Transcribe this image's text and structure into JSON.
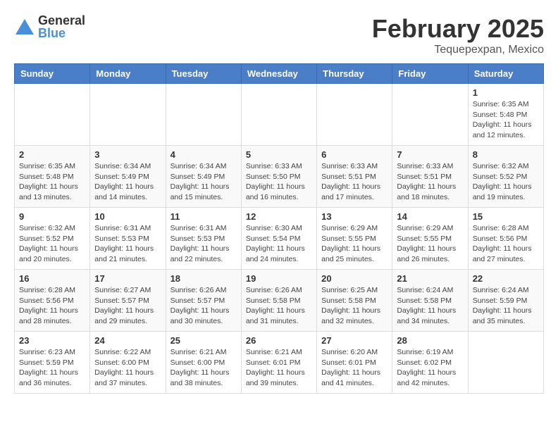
{
  "header": {
    "logo": {
      "general": "General",
      "blue": "Blue"
    },
    "title": "February 2025",
    "location": "Tequepexpan, Mexico"
  },
  "calendar": {
    "days_of_week": [
      "Sunday",
      "Monday",
      "Tuesday",
      "Wednesday",
      "Thursday",
      "Friday",
      "Saturday"
    ],
    "weeks": [
      [
        {
          "day": "",
          "info": ""
        },
        {
          "day": "",
          "info": ""
        },
        {
          "day": "",
          "info": ""
        },
        {
          "day": "",
          "info": ""
        },
        {
          "day": "",
          "info": ""
        },
        {
          "day": "",
          "info": ""
        },
        {
          "day": "1",
          "info": "Sunrise: 6:35 AM\nSunset: 5:48 PM\nDaylight: 11 hours\nand 12 minutes."
        }
      ],
      [
        {
          "day": "2",
          "info": "Sunrise: 6:35 AM\nSunset: 5:48 PM\nDaylight: 11 hours\nand 13 minutes."
        },
        {
          "day": "3",
          "info": "Sunrise: 6:34 AM\nSunset: 5:49 PM\nDaylight: 11 hours\nand 14 minutes."
        },
        {
          "day": "4",
          "info": "Sunrise: 6:34 AM\nSunset: 5:49 PM\nDaylight: 11 hours\nand 15 minutes."
        },
        {
          "day": "5",
          "info": "Sunrise: 6:33 AM\nSunset: 5:50 PM\nDaylight: 11 hours\nand 16 minutes."
        },
        {
          "day": "6",
          "info": "Sunrise: 6:33 AM\nSunset: 5:51 PM\nDaylight: 11 hours\nand 17 minutes."
        },
        {
          "day": "7",
          "info": "Sunrise: 6:33 AM\nSunset: 5:51 PM\nDaylight: 11 hours\nand 18 minutes."
        },
        {
          "day": "8",
          "info": "Sunrise: 6:32 AM\nSunset: 5:52 PM\nDaylight: 11 hours\nand 19 minutes."
        }
      ],
      [
        {
          "day": "9",
          "info": "Sunrise: 6:32 AM\nSunset: 5:52 PM\nDaylight: 11 hours\nand 20 minutes."
        },
        {
          "day": "10",
          "info": "Sunrise: 6:31 AM\nSunset: 5:53 PM\nDaylight: 11 hours\nand 21 minutes."
        },
        {
          "day": "11",
          "info": "Sunrise: 6:31 AM\nSunset: 5:53 PM\nDaylight: 11 hours\nand 22 minutes."
        },
        {
          "day": "12",
          "info": "Sunrise: 6:30 AM\nSunset: 5:54 PM\nDaylight: 11 hours\nand 24 minutes."
        },
        {
          "day": "13",
          "info": "Sunrise: 6:29 AM\nSunset: 5:55 PM\nDaylight: 11 hours\nand 25 minutes."
        },
        {
          "day": "14",
          "info": "Sunrise: 6:29 AM\nSunset: 5:55 PM\nDaylight: 11 hours\nand 26 minutes."
        },
        {
          "day": "15",
          "info": "Sunrise: 6:28 AM\nSunset: 5:56 PM\nDaylight: 11 hours\nand 27 minutes."
        }
      ],
      [
        {
          "day": "16",
          "info": "Sunrise: 6:28 AM\nSunset: 5:56 PM\nDaylight: 11 hours\nand 28 minutes."
        },
        {
          "day": "17",
          "info": "Sunrise: 6:27 AM\nSunset: 5:57 PM\nDaylight: 11 hours\nand 29 minutes."
        },
        {
          "day": "18",
          "info": "Sunrise: 6:26 AM\nSunset: 5:57 PM\nDaylight: 11 hours\nand 30 minutes."
        },
        {
          "day": "19",
          "info": "Sunrise: 6:26 AM\nSunset: 5:58 PM\nDaylight: 11 hours\nand 31 minutes."
        },
        {
          "day": "20",
          "info": "Sunrise: 6:25 AM\nSunset: 5:58 PM\nDaylight: 11 hours\nand 32 minutes."
        },
        {
          "day": "21",
          "info": "Sunrise: 6:24 AM\nSunset: 5:58 PM\nDaylight: 11 hours\nand 34 minutes."
        },
        {
          "day": "22",
          "info": "Sunrise: 6:24 AM\nSunset: 5:59 PM\nDaylight: 11 hours\nand 35 minutes."
        }
      ],
      [
        {
          "day": "23",
          "info": "Sunrise: 6:23 AM\nSunset: 5:59 PM\nDaylight: 11 hours\nand 36 minutes."
        },
        {
          "day": "24",
          "info": "Sunrise: 6:22 AM\nSunset: 6:00 PM\nDaylight: 11 hours\nand 37 minutes."
        },
        {
          "day": "25",
          "info": "Sunrise: 6:21 AM\nSunset: 6:00 PM\nDaylight: 11 hours\nand 38 minutes."
        },
        {
          "day": "26",
          "info": "Sunrise: 6:21 AM\nSunset: 6:01 PM\nDaylight: 11 hours\nand 39 minutes."
        },
        {
          "day": "27",
          "info": "Sunrise: 6:20 AM\nSunset: 6:01 PM\nDaylight: 11 hours\nand 41 minutes."
        },
        {
          "day": "28",
          "info": "Sunrise: 6:19 AM\nSunset: 6:02 PM\nDaylight: 11 hours\nand 42 minutes."
        },
        {
          "day": "",
          "info": ""
        }
      ]
    ]
  }
}
